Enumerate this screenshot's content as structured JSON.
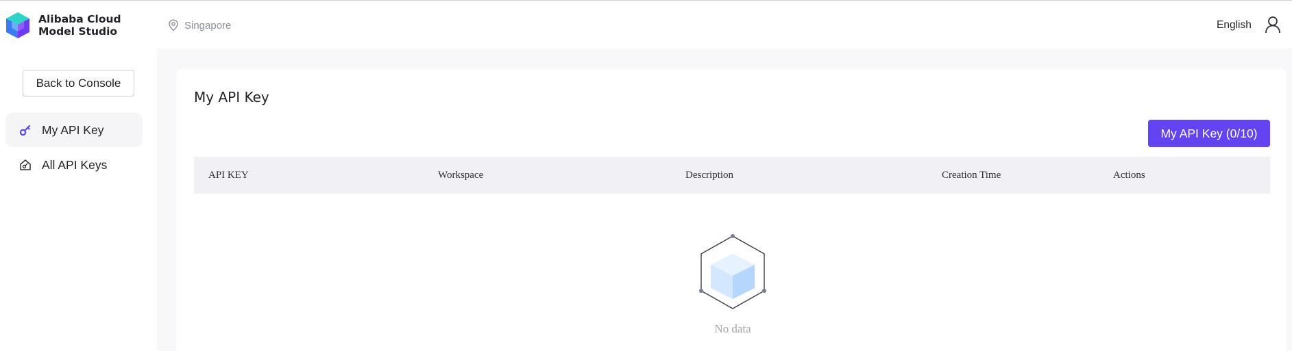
{
  "header": {
    "brand_line1": "Alibaba Cloud",
    "brand_line2": "Model Studio",
    "region": "Singapore",
    "language": "English"
  },
  "sidebar": {
    "back_label": "Back to Console",
    "items": [
      {
        "label": "My API Key",
        "icon": "key-icon",
        "active": true
      },
      {
        "label": "All API Keys",
        "icon": "house-key-icon",
        "active": false
      }
    ]
  },
  "main": {
    "title": "My API Key",
    "create_button": "My API Key (0/10)",
    "columns": [
      "API KEY",
      "Workspace",
      "Description",
      "Creation Time",
      "Actions"
    ],
    "rows": [],
    "empty_text": "No data"
  },
  "colors": {
    "accent": "#6343f2",
    "header_row": "#f1f1f5",
    "page_bg": "#f8f8fb",
    "muted_text": "#a5a8ae"
  }
}
